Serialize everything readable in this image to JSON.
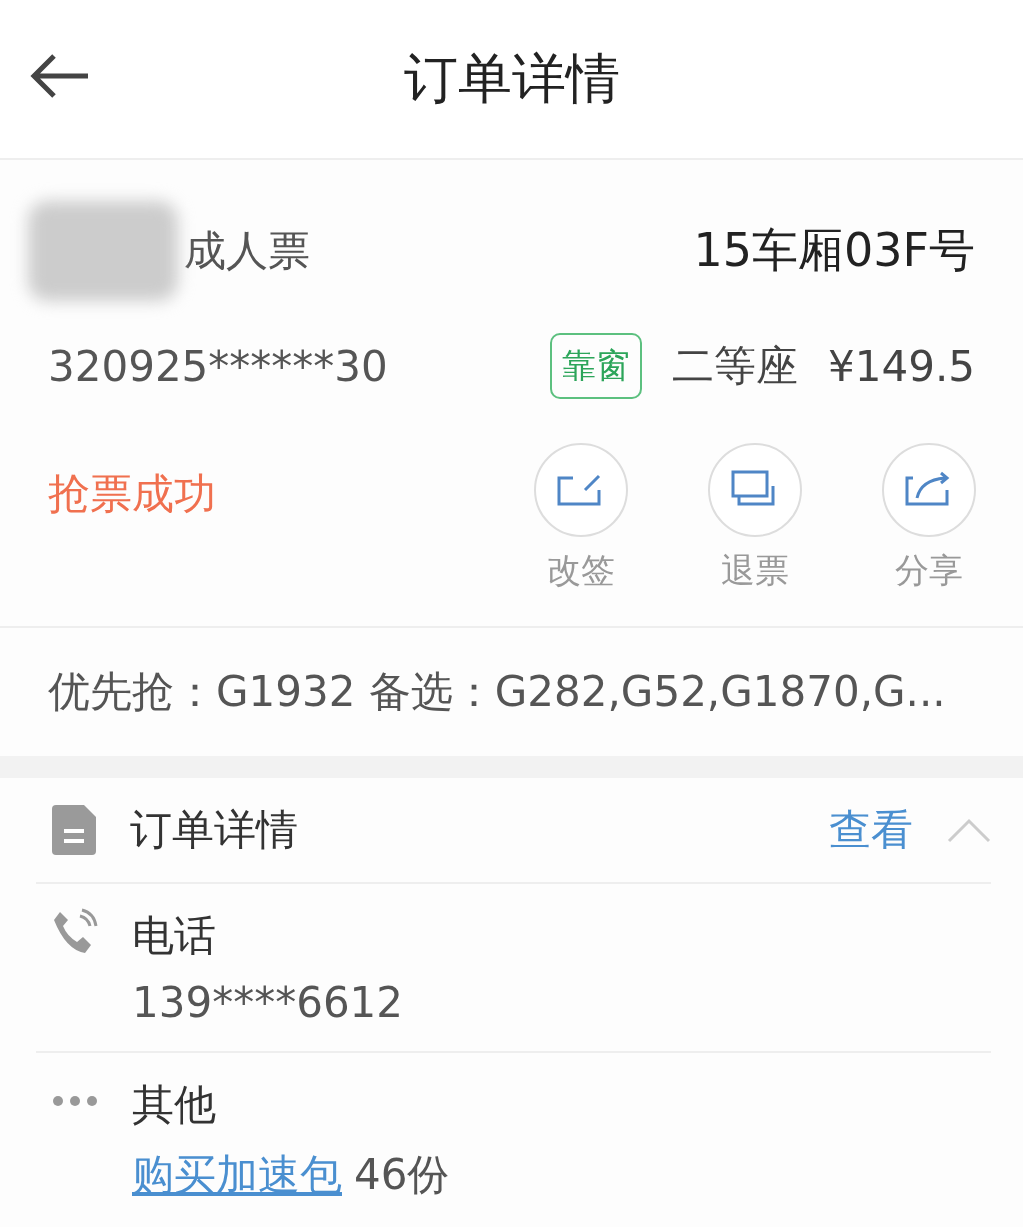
{
  "header": {
    "title": "订单详情"
  },
  "ticket": {
    "passenger_type": "成人票",
    "seat": "15车厢03F号",
    "id_number": "320925******30",
    "seat_tag": "靠窗",
    "seat_class": "二等座",
    "price": "¥149.5",
    "status": "抢票成功",
    "actions": [
      {
        "kind": "change",
        "label": "改签"
      },
      {
        "kind": "refund",
        "label": "退票"
      },
      {
        "kind": "share",
        "label": "分享"
      }
    ]
  },
  "trains": {
    "priority_label": "优先抢：",
    "priority": "G1932",
    "alternates_label": "备选：",
    "alternates": "G282,G52,G1870,G..."
  },
  "details": {
    "title": "订单详情",
    "link": "查看",
    "expanded": true,
    "items": [
      {
        "kind": "phone",
        "label": "电话",
        "value": "139****6612"
      },
      {
        "kind": "other",
        "label": "其他",
        "link": "购买加速包",
        "value": "46份"
      }
    ]
  }
}
